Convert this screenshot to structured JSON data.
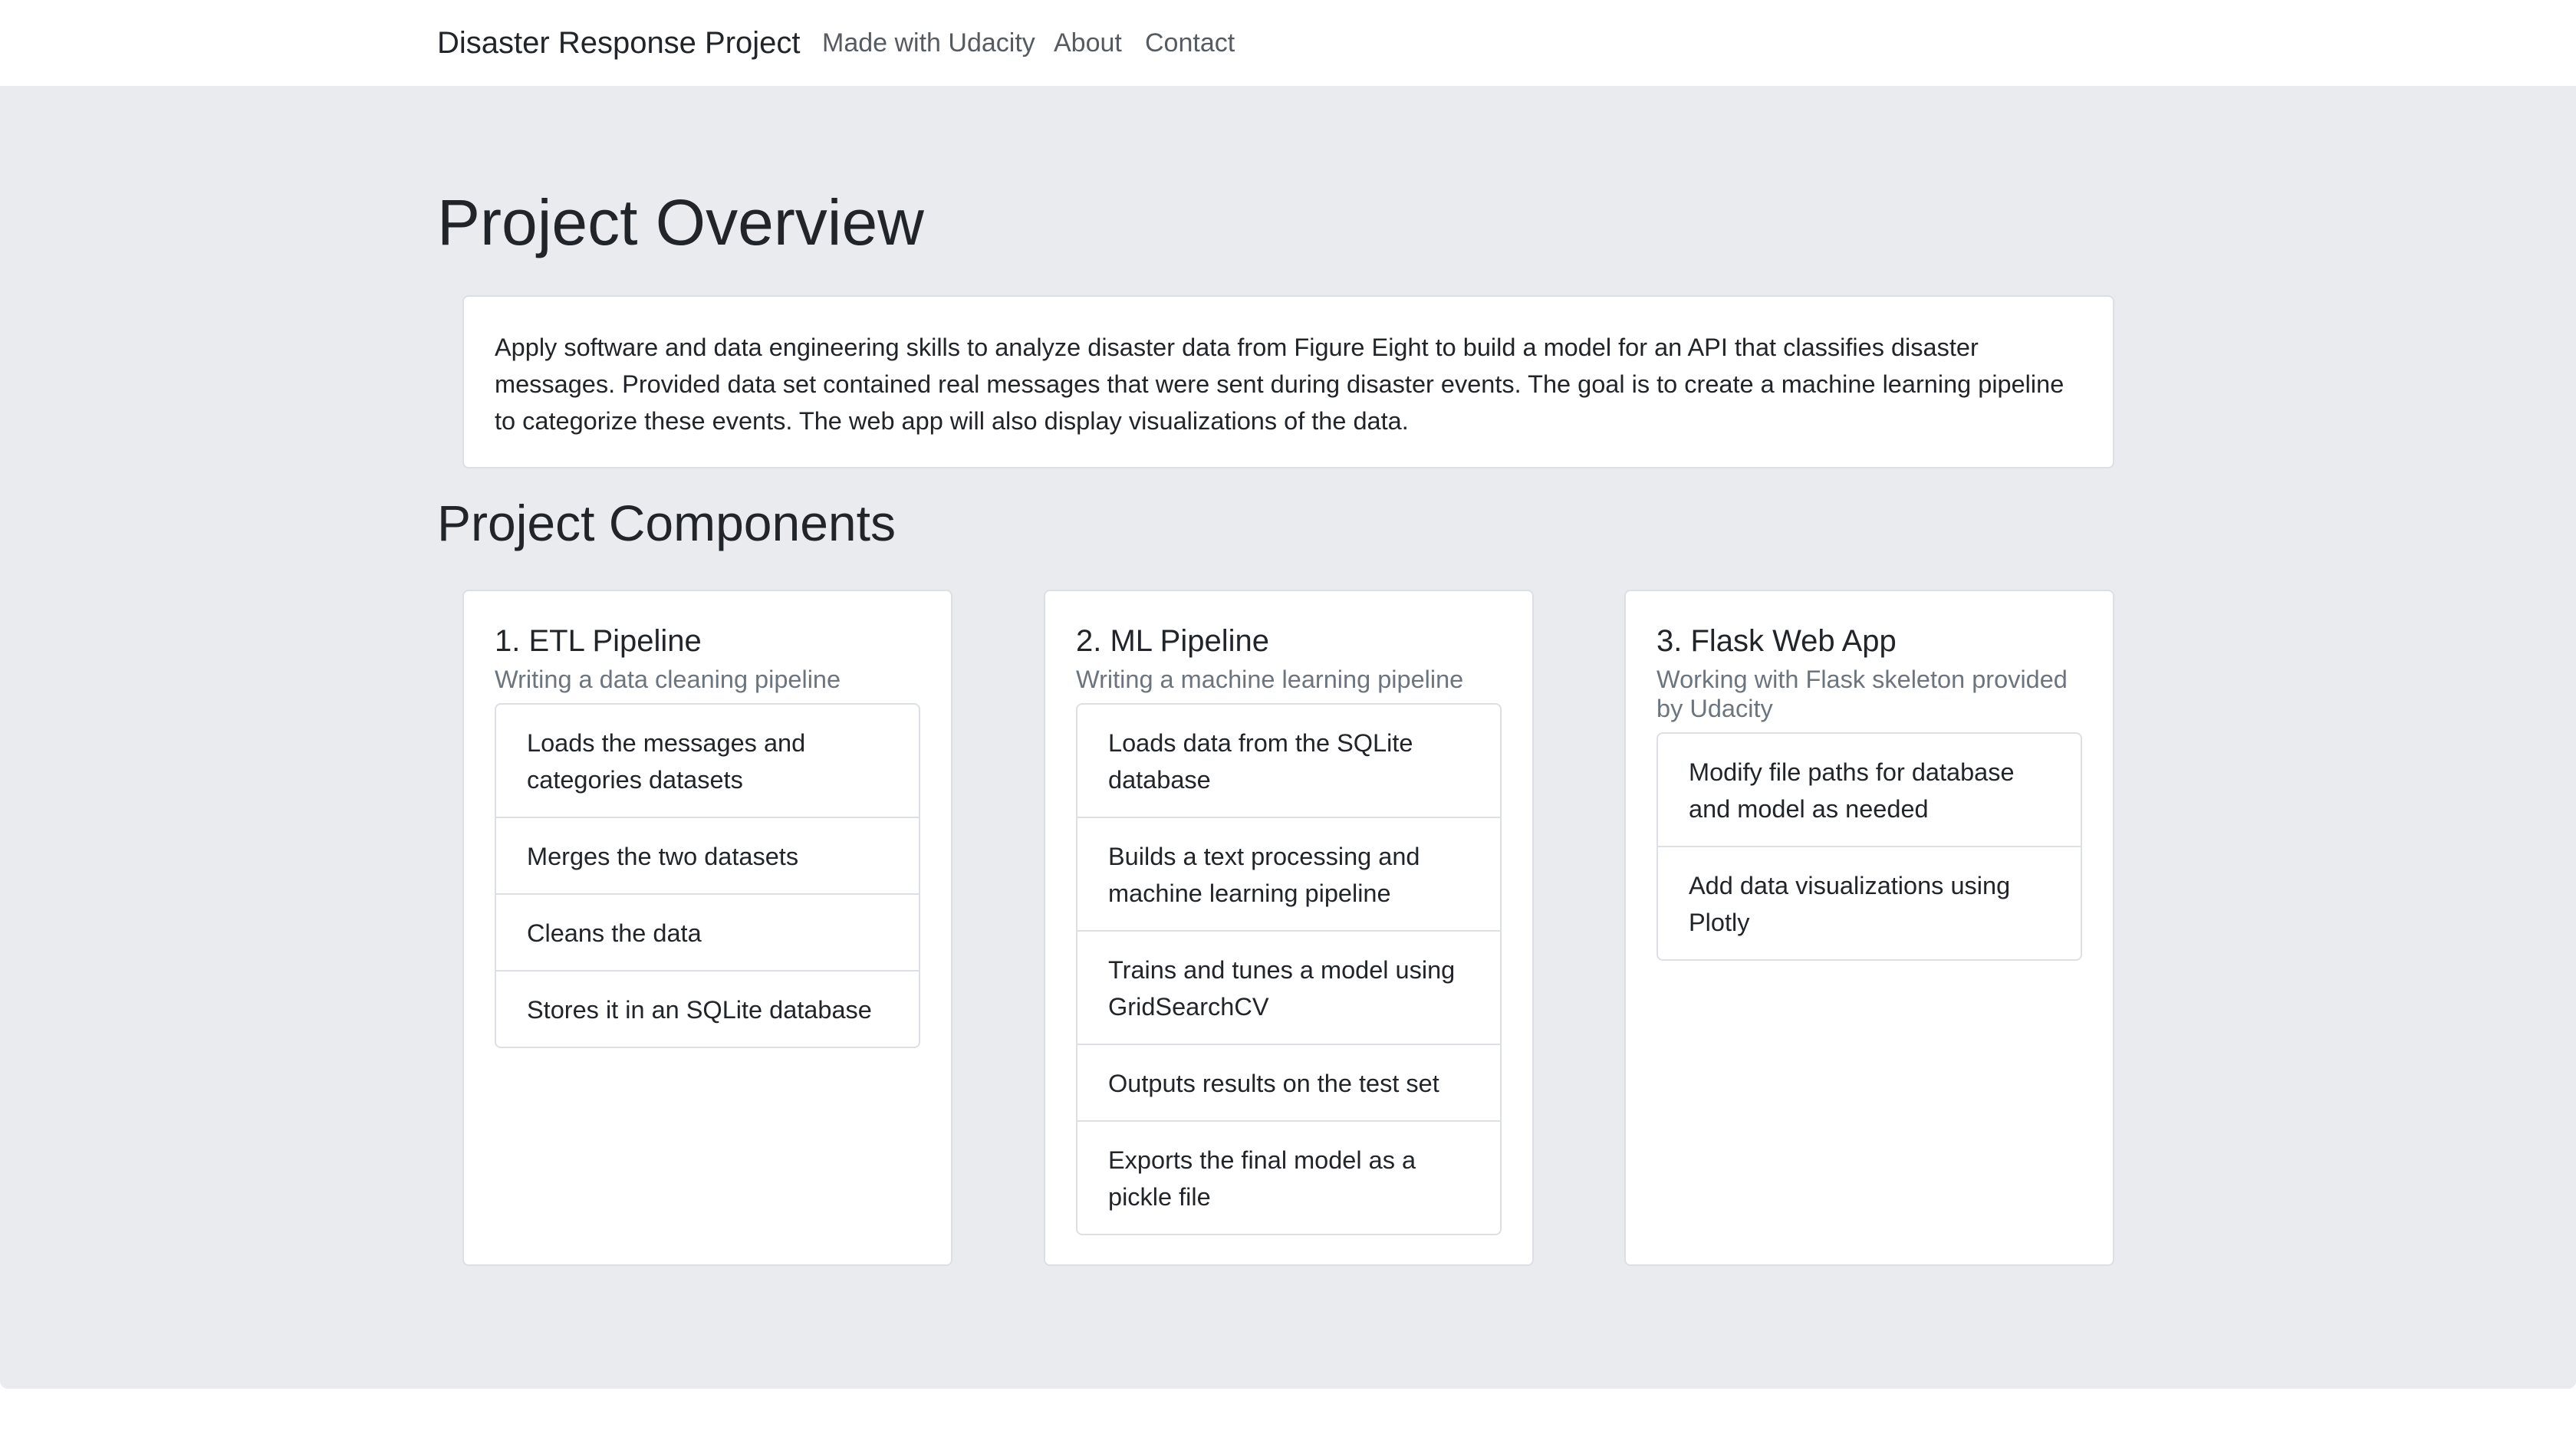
{
  "navbar": {
    "brand": "Disaster Response Project",
    "links": [
      {
        "label": "Made with Udacity"
      },
      {
        "label": "About"
      },
      {
        "label": "Contact"
      }
    ]
  },
  "overview": {
    "title": "Project Overview",
    "text": "Apply software and data engineering skills to analyze disaster data from Figure Eight to build a model for an API that classifies disaster messages. Provided data set contained real messages that were sent during disaster events. The goal is to create a machine learning pipeline to categorize these events. The web app will also display visualizations of the data."
  },
  "components": {
    "title": "Project Components",
    "cards": [
      {
        "title": "1. ETL Pipeline",
        "subtitle": "Writing a data cleaning pipeline",
        "items": [
          "Loads the messages and categories datasets",
          "Merges the two datasets",
          "Cleans the data",
          "Stores it in an SQLite database"
        ]
      },
      {
        "title": "2. ML Pipeline",
        "subtitle": "Writing a machine learning pipeline",
        "items": [
          "Loads data from the SQLite database",
          "Builds a text processing and machine learning pipeline",
          "Trains and tunes a model using GridSearchCV",
          "Outputs results on the test set",
          "Exports the final model as a pickle file"
        ]
      },
      {
        "title": "3. Flask Web App",
        "subtitle": "Working with Flask skeleton provided by Udacity",
        "items": [
          "Modify file paths for database and model as needed",
          "Add data visualizations using Plotly"
        ]
      }
    ]
  }
}
